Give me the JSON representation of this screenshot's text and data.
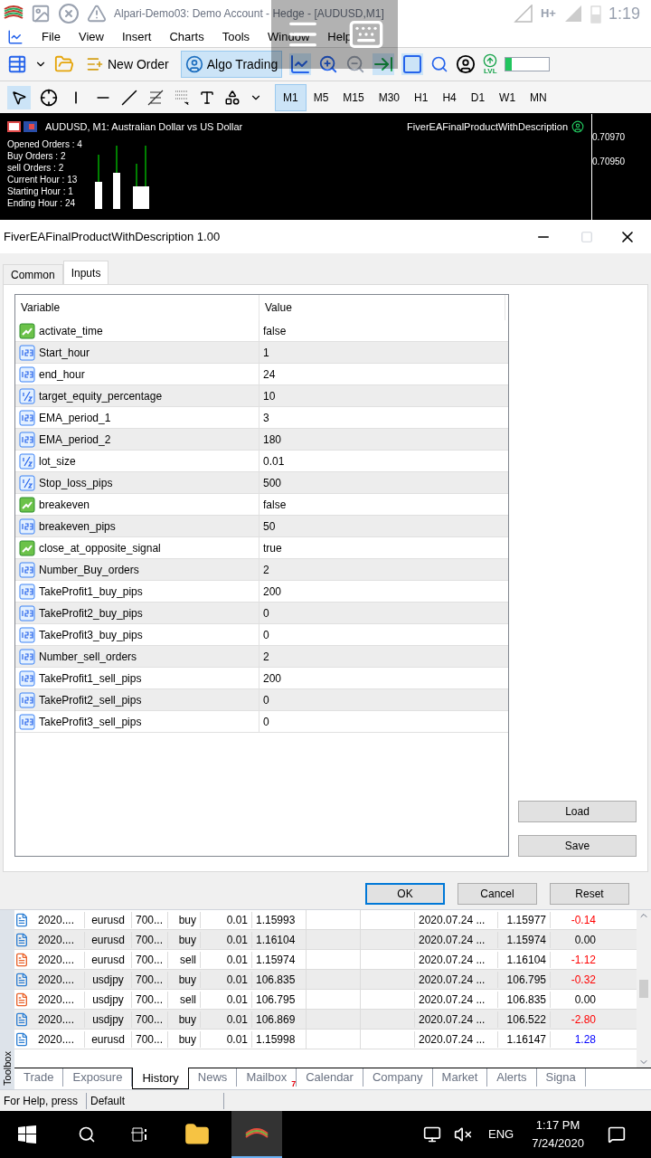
{
  "android_status": {
    "network": "H+",
    "time": "1:19"
  },
  "window": {
    "title": "Alpari-Demo03: Demo Account - Hedge - [AUDUSD,M1]"
  },
  "menu": [
    "File",
    "View",
    "Insert",
    "Charts",
    "Tools",
    "Window",
    "Help"
  ],
  "toolbar": [
    {
      "label": "New Order",
      "selected": false
    },
    {
      "label": "Algo Trading",
      "selected": true
    }
  ],
  "lvl_label": "LVL",
  "connection": {
    "level": 0.15
  },
  "timeframes": [
    {
      "label": "M1",
      "selected": true
    },
    {
      "label": "M5",
      "selected": false
    },
    {
      "label": "M15",
      "selected": false
    },
    {
      "label": "M30",
      "selected": false
    },
    {
      "label": "H1",
      "selected": false
    },
    {
      "label": "H4",
      "selected": false
    },
    {
      "label": "D1",
      "selected": false
    },
    {
      "label": "W1",
      "selected": false
    },
    {
      "label": "MN",
      "selected": false
    }
  ],
  "chart": {
    "title": "AUDUSD, M1:  Australian Dollar vs US Dollar",
    "expert": "FiverEAFinalProductWithDescription",
    "info": [
      "Opened Orders : 4",
      "Buy Orders : 2",
      "sell Orders : 2",
      "Current Hour : 13",
      "Starting Hour : 1",
      "Ending Hour : 24"
    ],
    "price_labels": [
      "0.70970",
      "0.70950"
    ]
  },
  "dialog": {
    "title": "FiverEAFinalProductWithDescription 1.00",
    "tabs": [
      {
        "label": "Common",
        "selected": false
      },
      {
        "label": "Inputs",
        "selected": true
      }
    ],
    "columns": [
      "Variable",
      "Value"
    ],
    "inputs": [
      {
        "kind": "bool",
        "name": "activate_time",
        "value": "false"
      },
      {
        "kind": "int",
        "name": "Start_hour",
        "value": "1"
      },
      {
        "kind": "int",
        "name": "end_hour",
        "value": "24"
      },
      {
        "kind": "double",
        "name": "target_equity_percentage",
        "value": "10"
      },
      {
        "kind": "int",
        "name": "EMA_period_1",
        "value": "3"
      },
      {
        "kind": "int",
        "name": "EMA_period_2",
        "value": "180"
      },
      {
        "kind": "double",
        "name": "lot_size",
        "value": "0.01"
      },
      {
        "kind": "double",
        "name": "Stop_loss_pips",
        "value": "500"
      },
      {
        "kind": "bool",
        "name": "breakeven",
        "value": "false"
      },
      {
        "kind": "int",
        "name": "breakeven_pips",
        "value": "50"
      },
      {
        "kind": "bool",
        "name": "close_at_opposite_signal",
        "value": "true"
      },
      {
        "kind": "int",
        "name": "Number_Buy_orders",
        "value": "2"
      },
      {
        "kind": "int",
        "name": "TakeProfit1_buy_pips",
        "value": "200"
      },
      {
        "kind": "int",
        "name": "TakeProfit2_buy_pips",
        "value": "0"
      },
      {
        "kind": "int",
        "name": "TakeProfit3_buy_pips",
        "value": "0"
      },
      {
        "kind": "int",
        "name": "Number_sell_orders",
        "value": "2"
      },
      {
        "kind": "int",
        "name": "TakeProfit1_sell_pips",
        "value": "200"
      },
      {
        "kind": "int",
        "name": "TakeProfit2_sell_pips",
        "value": "0"
      },
      {
        "kind": "int",
        "name": "TakeProfit3_sell_pips",
        "value": "0"
      }
    ],
    "side_buttons": [
      "Load",
      "Save"
    ],
    "buttons": [
      {
        "label": "OK",
        "default": true
      },
      {
        "label": "Cancel",
        "default": false
      },
      {
        "label": "Reset",
        "default": false
      }
    ]
  },
  "history": [
    {
      "kind": "buy",
      "time": "2020....",
      "symbol": "eurusd",
      "ticket": "700...",
      "type": "buy",
      "volume": "0.01",
      "open": "1.15993",
      "close_time": "2020.07.24 ...",
      "close": "1.15977",
      "profit": "-0.14",
      "color": "#ff0000"
    },
    {
      "kind": "buy",
      "time": "2020....",
      "symbol": "eurusd",
      "ticket": "700...",
      "type": "buy",
      "volume": "0.01",
      "open": "1.16104",
      "close_time": "2020.07.24 ...",
      "close": "1.15974",
      "profit": "0.00"
    },
    {
      "kind": "sell",
      "time": "2020....",
      "symbol": "eurusd",
      "ticket": "700...",
      "type": "sell",
      "volume": "0.01",
      "open": "1.15974",
      "close_time": "2020.07.24 ...",
      "close": "1.16104",
      "profit": "-1.12",
      "color": "#ff0000"
    },
    {
      "kind": "buy",
      "time": "2020....",
      "symbol": "usdjpy",
      "ticket": "700...",
      "type": "buy",
      "volume": "0.01",
      "open": "106.835",
      "close_time": "2020.07.24 ...",
      "close": "106.795",
      "profit": "-0.32",
      "color": "#ff0000"
    },
    {
      "kind": "sell",
      "time": "2020....",
      "symbol": "usdjpy",
      "ticket": "700...",
      "type": "sell",
      "volume": "0.01",
      "open": "106.795",
      "close_time": "2020.07.24 ...",
      "close": "106.835",
      "profit": "0.00"
    },
    {
      "kind": "buy",
      "time": "2020....",
      "symbol": "usdjpy",
      "ticket": "700...",
      "type": "buy",
      "volume": "0.01",
      "open": "106.869",
      "close_time": "2020.07.24 ...",
      "close": "106.522",
      "profit": "-2.80",
      "color": "#ff0000"
    },
    {
      "kind": "buy",
      "time": "2020....",
      "symbol": "eurusd",
      "ticket": "700...",
      "type": "buy",
      "volume": "0.01",
      "open": "1.15998",
      "close_time": "2020.07.24 ...",
      "close": "1.16147",
      "profit": "1.28",
      "color": "#0000ff"
    }
  ],
  "toolbox_label": "Toolbox",
  "bottom_tabs": [
    {
      "label": "Trade",
      "selected": false
    },
    {
      "label": "Exposure",
      "selected": false
    },
    {
      "label": "History",
      "selected": true
    },
    {
      "label": "News",
      "selected": false
    },
    {
      "label": "Mailbox",
      "selected": false,
      "badge": "7"
    },
    {
      "label": "Calendar",
      "selected": false
    },
    {
      "label": "Company",
      "selected": false
    },
    {
      "label": "Market",
      "selected": false
    },
    {
      "label": "Alerts",
      "selected": false
    },
    {
      "label": "Signa",
      "selected": false
    }
  ],
  "status_bar": [
    "For Help, press",
    "Default"
  ],
  "taskbar": {
    "language": "ENG",
    "time": "1:17 PM",
    "date": "7/24/2020"
  }
}
